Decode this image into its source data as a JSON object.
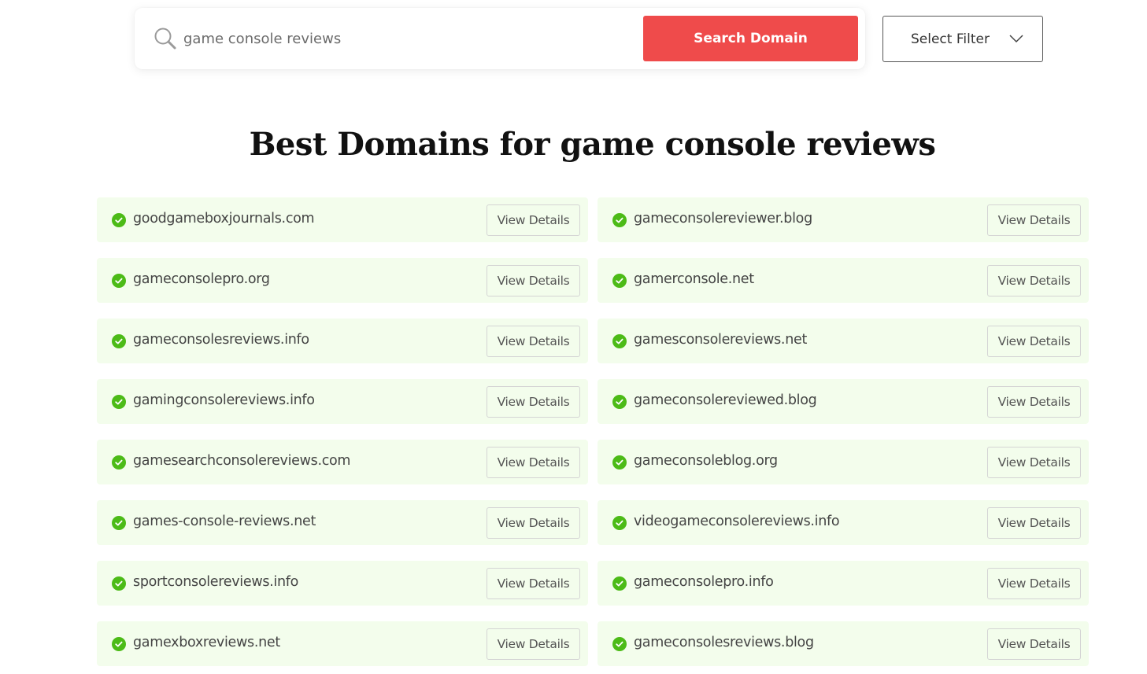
{
  "search": {
    "value": "game console reviews",
    "button_label": "Search Domain",
    "icon": "search-icon"
  },
  "filter": {
    "label": "Select Filter",
    "icon": "chevron-down-icon"
  },
  "heading": {
    "prefix": "Best Domains for ",
    "query": "game console reviews"
  },
  "colors": {
    "accent": "#ef4b4b",
    "row_bg": "#f3fdec",
    "check_green": "#4cbb17"
  },
  "view_details_label": "View Details",
  "domains": [
    {
      "name": "goodgameboxjournals.com",
      "available": true
    },
    {
      "name": "gameconsolereviewer.blog",
      "available": true
    },
    {
      "name": "gameconsolepro.org",
      "available": true
    },
    {
      "name": "gamerconsole.net",
      "available": true
    },
    {
      "name": "gameconsolesreviews.info",
      "available": true
    },
    {
      "name": "gamesconsolereviews.net",
      "available": true
    },
    {
      "name": "gamingconsolereviews.info",
      "available": true
    },
    {
      "name": "gameconsolereviewed.blog",
      "available": true
    },
    {
      "name": "gamesearchconsolereviews.com",
      "available": true
    },
    {
      "name": "gameconsoleblog.org",
      "available": true
    },
    {
      "name": "games-console-reviews.net",
      "available": true
    },
    {
      "name": "videogameconsolereviews.info",
      "available": true
    },
    {
      "name": "sportconsolereviews.info",
      "available": true
    },
    {
      "name": "gameconsolepro.info",
      "available": true
    },
    {
      "name": "gamexboxreviews.net",
      "available": true
    },
    {
      "name": "gameconsolesreviews.blog",
      "available": true
    }
  ]
}
